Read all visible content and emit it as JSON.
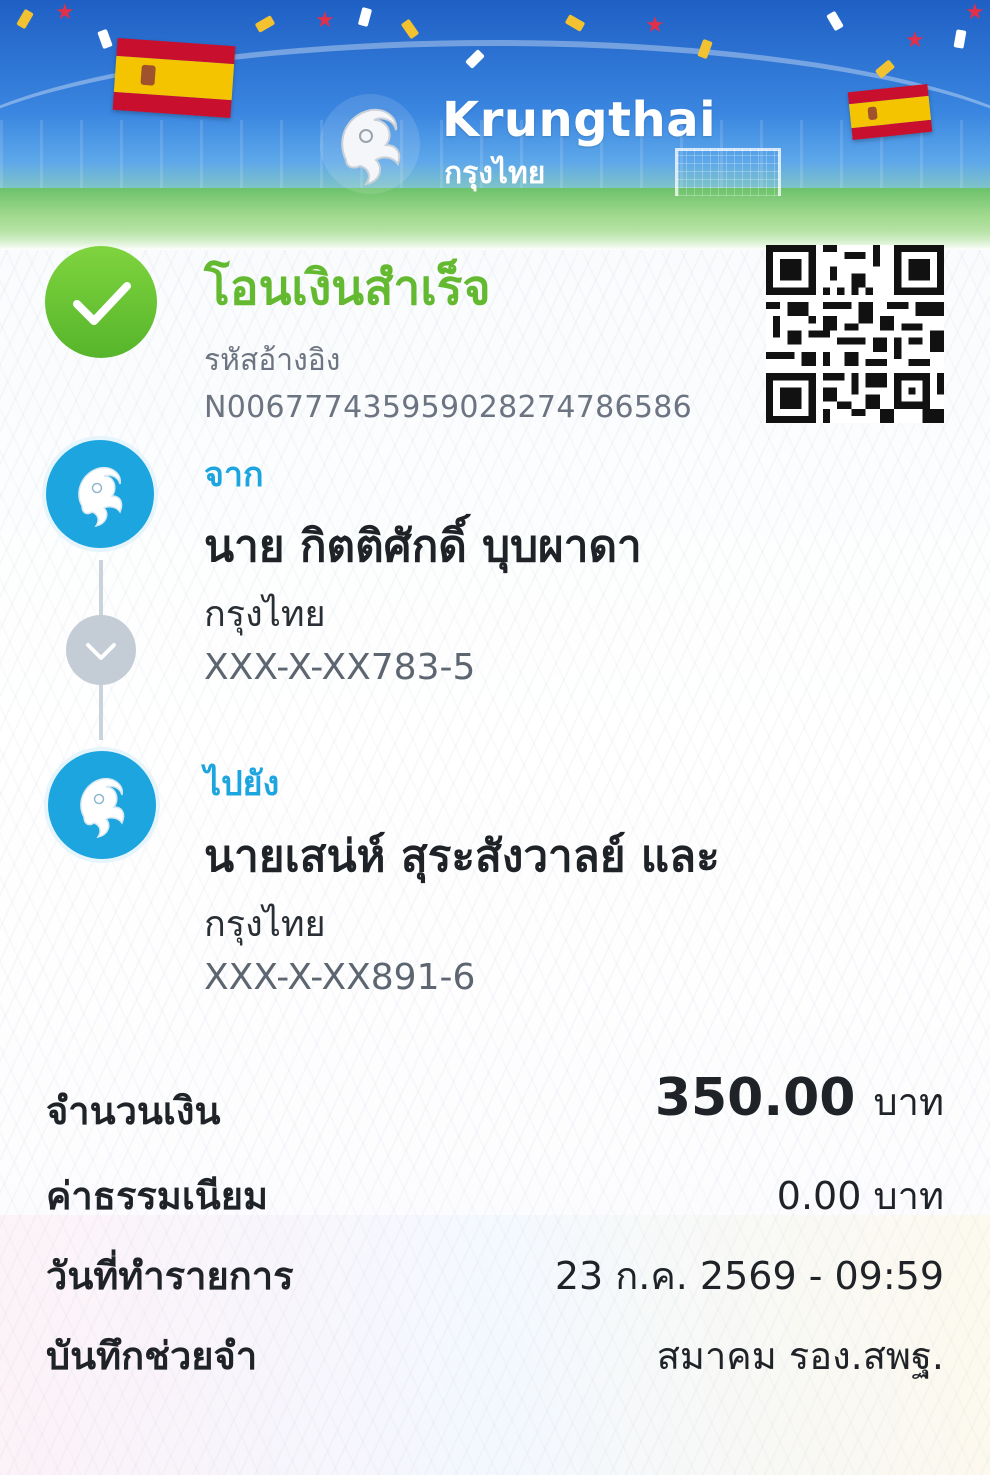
{
  "header": {
    "brand_en": "Krungthai",
    "brand_th": "กรุงไทย"
  },
  "status": {
    "title": "โอนเงินสำเร็จ",
    "ref_label": "รหัสอ้างอิง",
    "ref_value": "N006777435959028274786586",
    "icon": "check-icon",
    "color": "#63b930"
  },
  "from": {
    "label": "จาก",
    "name": "นาย กิตติศักดิ์ บุบผาดา",
    "bank": "กรุงไทย",
    "account": "XXX-X-XX783-5"
  },
  "to": {
    "label": "ไปยัง",
    "name": "นายเสน่ห์ สุระสังวาลย์ และ",
    "bank": "กรุงไทย",
    "account": "XXX-X-XX891-6"
  },
  "details": {
    "amount_label": "จำนวนเงิน",
    "amount_value": "350.00",
    "amount_unit": "บาท",
    "fee_label": "ค่าธรรมเนียม",
    "fee_value": "0.00 บาท",
    "date_label": "วันที่ทำรายการ",
    "date_value": "23 ก.ค. 2569 - 09:59",
    "memo_label": "บันทึกช่วยจำ",
    "memo_value": "สมาคม รอง.สพฐ."
  },
  "colors": {
    "accent_blue": "#1ca5df",
    "success_green": "#63b930",
    "connector_gray": "#c4cdd5"
  }
}
